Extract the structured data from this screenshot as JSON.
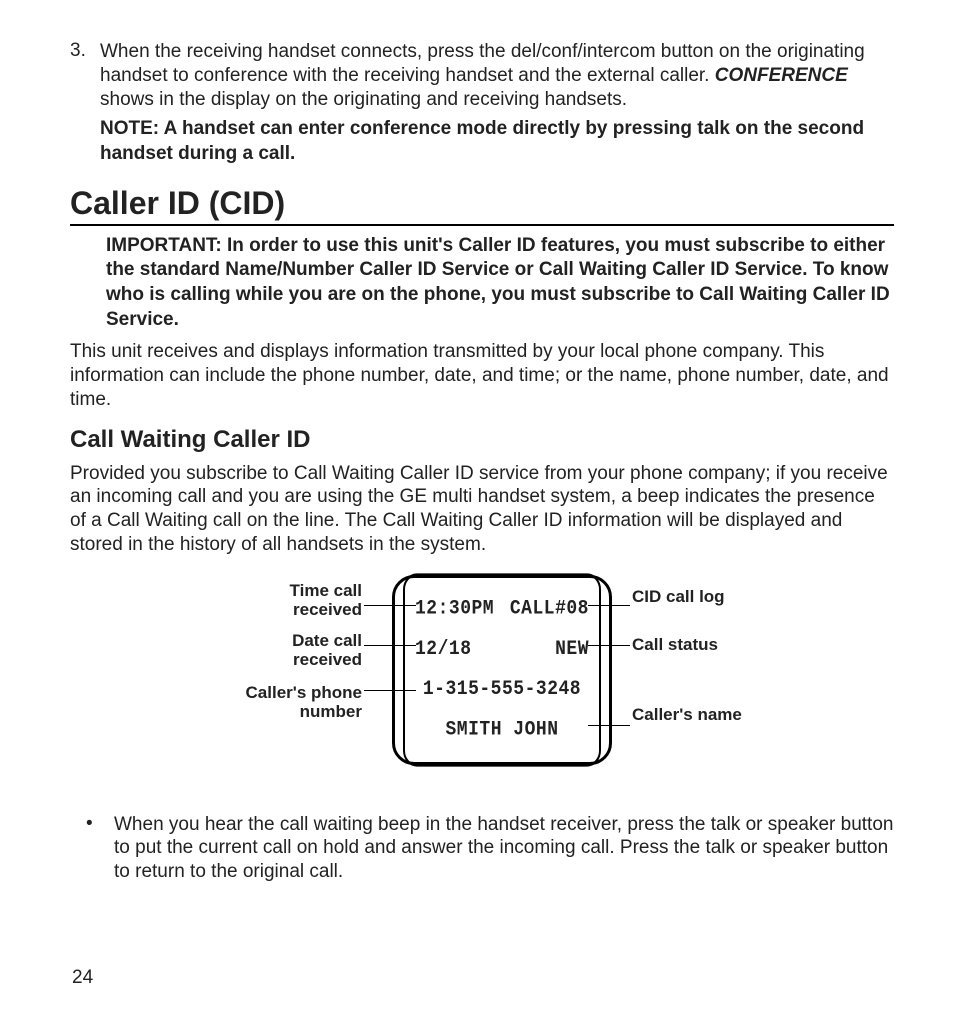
{
  "step3": {
    "number": "3.",
    "text_before": "When the receiving handset connects, press the del/conf/intercom button on the originating handset to conference with the receiving handset and the external caller. ",
    "conf_word": "CONFERENCE",
    "text_after": " shows in the display on the originating and receiving handsets.",
    "note": "NOTE: A handset can enter conference mode directly by pressing talk on the second handset during a call."
  },
  "cid": {
    "heading": "Caller ID (CID)",
    "important": "IMPORTANT: In order to use this unit's Caller ID features, you must subscribe to either the standard Name/Number Caller ID Service or Call Waiting Caller ID Service. To know who is calling while you are on the phone, you must subscribe to Call Waiting Caller ID Service.",
    "body": "This unit receives and displays information transmitted by your local phone company. This information can include the phone number, date, and time; or the name, phone number, date, and time."
  },
  "cw": {
    "heading": "Call Waiting Caller ID",
    "body": "Provided you subscribe to Call Waiting Caller ID service from your phone company; if you receive an incoming call and you are using the GE multi handset system, a beep indicates the presence of a Call Waiting call on the line.  The Call Waiting Caller ID information will be displayed and stored in the history of all handsets in the system."
  },
  "lcd": {
    "time": "12:30PM",
    "call_log": "CALL#08",
    "date": "12/18",
    "status": "NEW",
    "phone": "1-315-555-3248",
    "name": "SMITH JOHN"
  },
  "labels": {
    "time": "Time call received",
    "date": "Date call received",
    "phone": "Caller's phone number",
    "log": "CID call log",
    "status": "Call status",
    "name": "Caller's name"
  },
  "bullet": {
    "text": "When you hear the call waiting beep in the handset receiver, press the talk or speaker button to put the current call on hold and answer the incoming call. Press the talk or speaker button to return to the original call."
  },
  "page_number": "24"
}
